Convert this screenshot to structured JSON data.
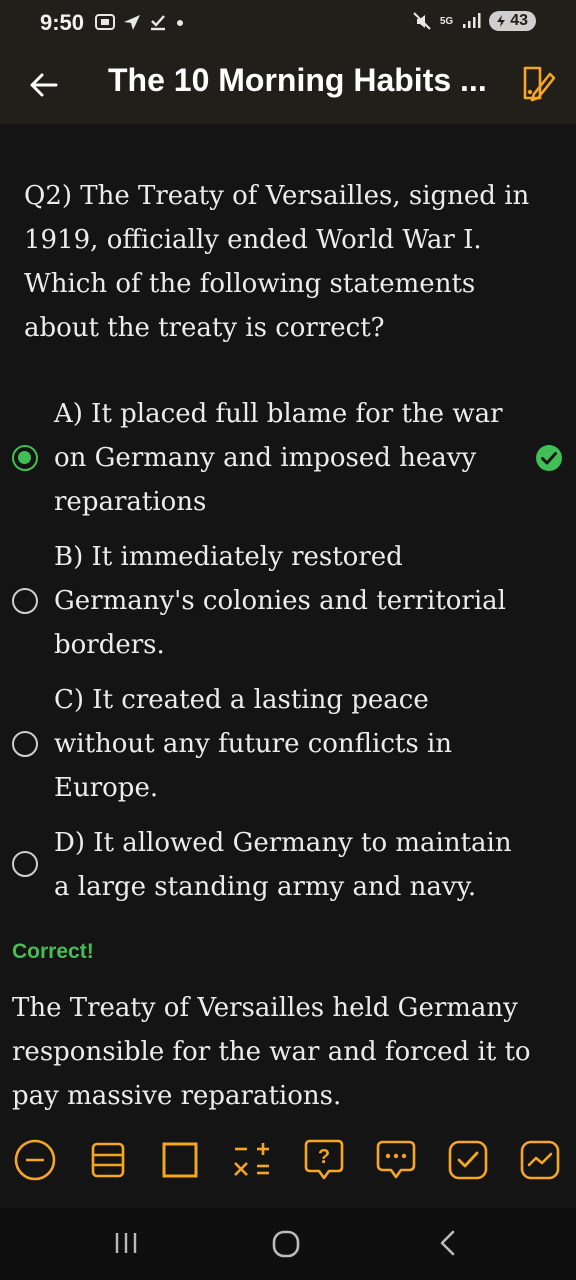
{
  "status": {
    "time": "9:50",
    "network": "5G",
    "battery": "43"
  },
  "app_bar": {
    "title": "The 10 Morning Habits ..."
  },
  "question": "Q2) The Treaty of Versailles, signed in 1919, officially ended World War I. Which of the following statements about the treaty is correct?",
  "options": [
    {
      "text": "A) It placed full blame for the war on Germany and imposed heavy reparations",
      "selected": true,
      "correct": true
    },
    {
      "text": "B) It immediately restored Germany's colonies and territorial borders.",
      "selected": false
    },
    {
      "text": "C) It created a lasting peace without any future conflicts in Europe.",
      "selected": false
    },
    {
      "text": "D) It allowed Germany to maintain a large standing army and navy.",
      "selected": false
    }
  ],
  "result_label": "Correct!",
  "explanation": "The Treaty of Versailles held Germany responsible for the war and forced it to pay massive reparations.",
  "toolbar": [
    "minus-circle-icon",
    "notes-icon",
    "square-icon",
    "calculator-icon",
    "question-icon",
    "chat-icon",
    "check-icon",
    "chart-icon"
  ],
  "colors": {
    "accent": "#f5a623",
    "correct": "#3fbf55",
    "appbar": "#221f1a",
    "background": "#141414"
  }
}
